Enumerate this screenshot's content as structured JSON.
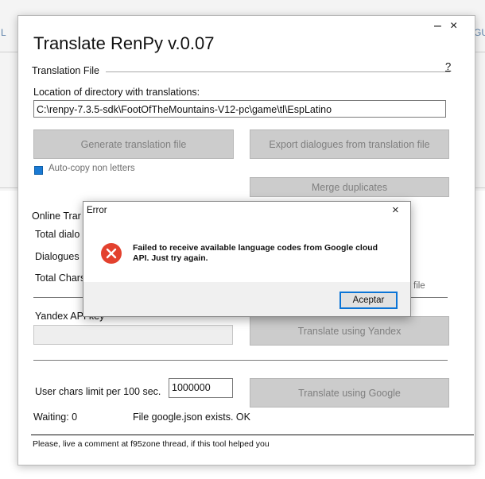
{
  "background": {
    "left_edge_text": "L",
    "right_edge_text": "GU"
  },
  "window": {
    "title": "Translate RenPy  v.0.07",
    "minimize_glyph": "–",
    "close_glyph": "×",
    "help_link": "?",
    "translation_file_section": "Translation File",
    "location_label": "Location of directory with translations:",
    "location_value": "C:\\renpy-7.3.5-sdk\\FootOfTheMountains-V12-pc\\game\\tl\\EspLatino",
    "generate_button": "Generate translation file",
    "export_button": "Export dialogues from translation file",
    "auto_copy_label": "Auto-copy non letters",
    "auto_copy_checked": true,
    "merge_button": "Merge duplicates",
    "online_section": "Online Trar",
    "total_dialogues_label": "Total dialo",
    "dialogues_label": "Dialogues",
    "total_chars_label": "Total Chars",
    "file_fragment": "file",
    "yandex_key_label": "Yandex API key",
    "yandex_key_value": "",
    "translate_yandex_button": "Translate using Yandex",
    "user_chars_label": "User chars limit per 100 sec.",
    "user_chars_value": "1000000",
    "translate_google_button": "Translate using Google",
    "waiting_text": "Waiting: 0",
    "google_status": "File google.json exists. OK",
    "footer": "Please, live a comment at f95zone thread, if this tool helped you"
  },
  "dialog": {
    "title": "Error",
    "close_glyph": "×",
    "icon": "error-icon",
    "message": "Failed to receive available language codes from Google cloud API. Just try again.",
    "ok_button": "Aceptar"
  },
  "colors": {
    "accent": "#0b74d6",
    "error_red": "#e3412e",
    "disabled_button": "#cccccc"
  }
}
